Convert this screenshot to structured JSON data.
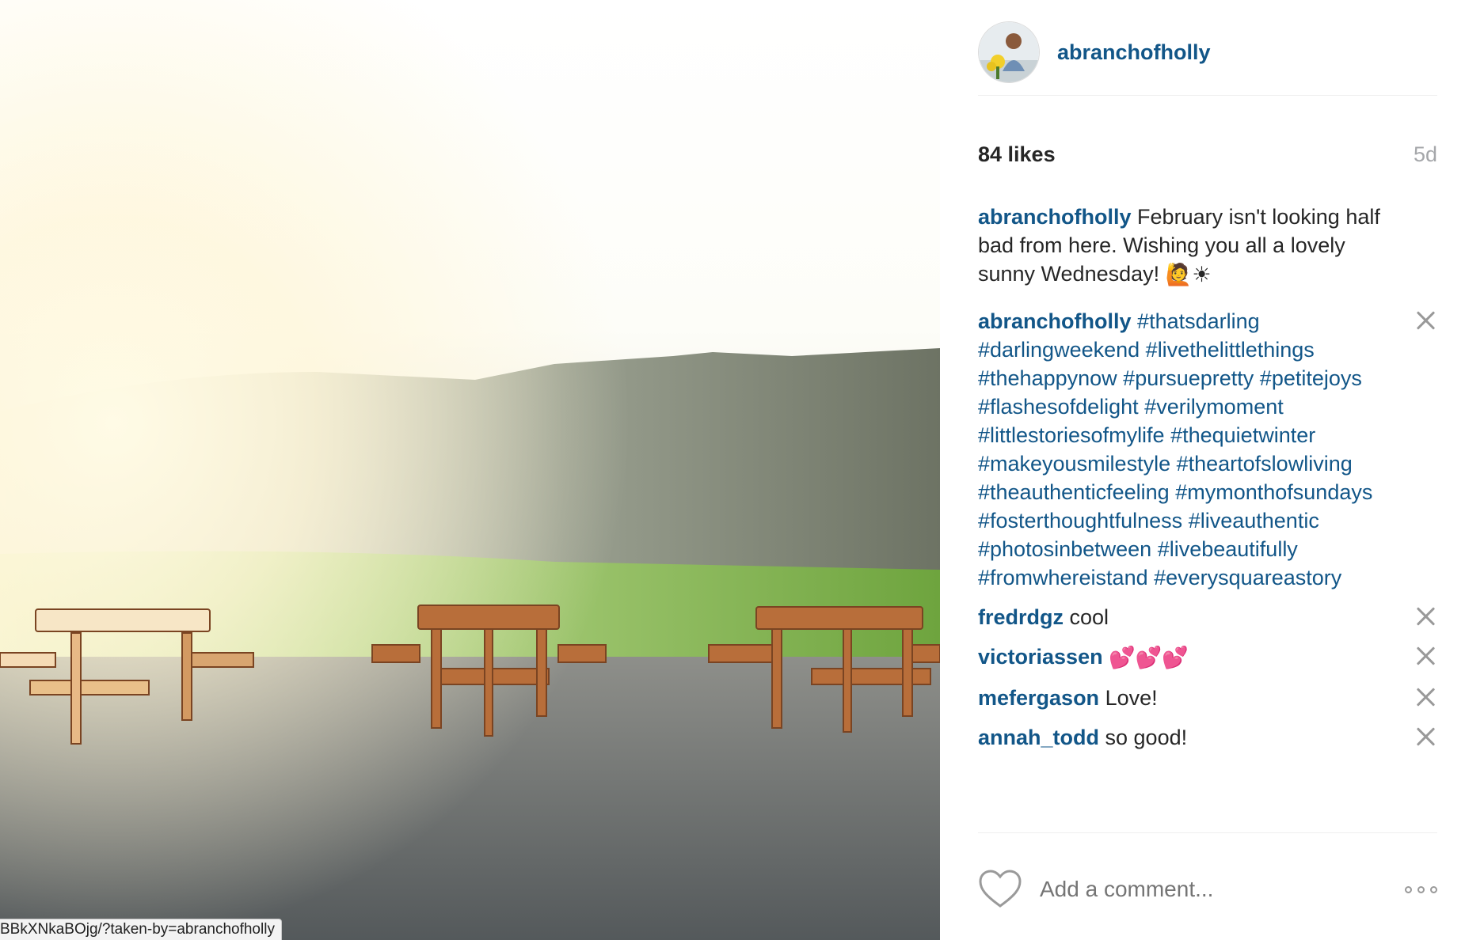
{
  "post": {
    "username": "abranchofholly",
    "likes": "84 likes",
    "age": "5d",
    "caption": {
      "user": "abranchofholly",
      "text": "February isn't looking half bad from here. Wishing you all a lovely sunny Wednesday!",
      "emoji": "🙋☀"
    },
    "hashtag_comment": {
      "user": "abranchofholly",
      "tags": [
        "#thatsdarling",
        "#darlingweekend",
        "#livethelittlethings",
        "#thehappynow",
        "#pursuepretty",
        "#petitejoys",
        "#flashesofdelight",
        "#verilymoment",
        "#littlestoriesofmylife",
        "#thequietwinter",
        "#makeyousmilestyle",
        "#theartofslowliving",
        "#theauthenticfeeling",
        "#mymonthofsundays",
        "#fosterthoughtfulness",
        "#liveauthentic",
        "#photosinbetween",
        "#livebeautifully",
        "#fromwhereistand",
        "#everysquareastory"
      ]
    },
    "comments": [
      {
        "user": "fredrdgz",
        "text": "cool"
      },
      {
        "user": "victoriassen",
        "text": "💕💕💕"
      },
      {
        "user": "mefergason",
        "text": "Love!"
      },
      {
        "user": "annah_todd",
        "text": "so good!"
      }
    ],
    "add_comment_placeholder": "Add a comment..."
  },
  "status_bar": {
    "url": "BBkXNkaBOjg/?taken-by=abranchofholly"
  },
  "icons": {
    "heart": "heart-outline-icon",
    "remove": "close-icon",
    "more": "more-options-icon"
  },
  "colors": {
    "link": "#125688",
    "muted": "#a5a7aa",
    "text": "#262626"
  }
}
